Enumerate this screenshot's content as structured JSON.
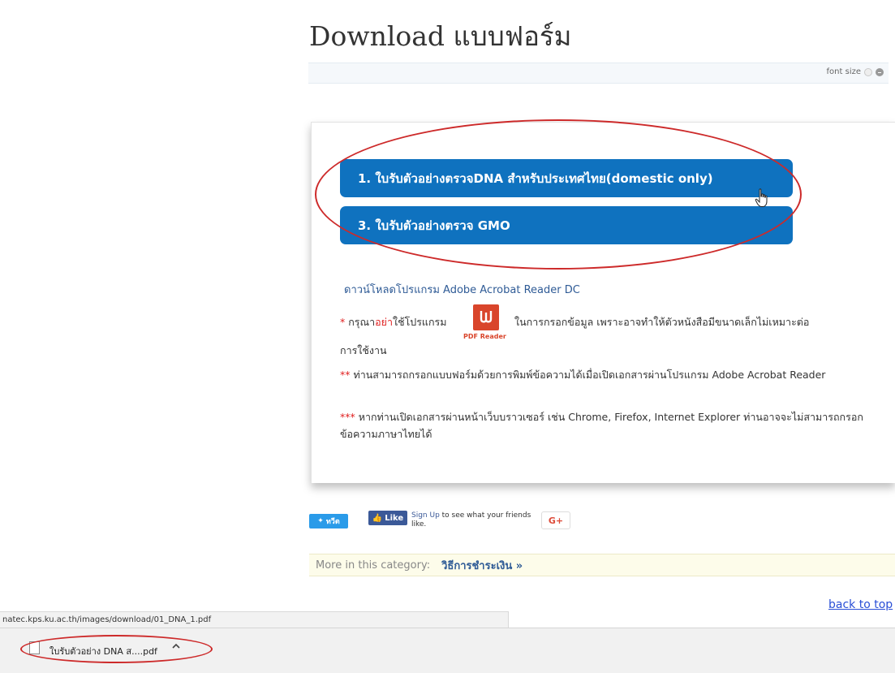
{
  "page": {
    "title": "Download แบบฟอร์ม",
    "font_size_label": "font size"
  },
  "downloads": {
    "buttons": [
      {
        "label": "1. ใบรับตัวอย่างตรวจDNA สำหรับประเทศไทย(domestic only)"
      },
      {
        "label": "3. ใบรับตัวอย่างตรวจ GMO"
      }
    ]
  },
  "acrobat": {
    "link_text": "ดาวน์โหลดโปรแกรม Adobe Acrobat Reader DC",
    "pdf_reader_label": "PDF Reader"
  },
  "notes": {
    "note1": {
      "marker": "*",
      "prefix": " กรุณา",
      "highlight": "อย่า",
      "middle": "ใช้โปรแกรม",
      "suffix": "ในการกรอกข้อมูล เพราะอาจทำให้ตัวหนังสือมีขนาดเล็กไม่เหมาะต่อ",
      "line2": "การใช้งาน"
    },
    "note2": {
      "marker": "**",
      "text": " ท่านสามารถกรอกแบบฟอร์มด้วยการพิมพ์ข้อความได้เมื่อเปิดเอกสารผ่านโปรแกรม Adobe Acrobat Reader"
    },
    "note3": {
      "marker": "***",
      "text": " หากท่านเปิดเอกสารผ่านหน้าเว็บบราวเซอร์ เช่น Chrome, Firefox, Internet Explorer ท่านอาจจะไม่สามารถกรอกข้อความภาษาไทยได้"
    }
  },
  "share": {
    "twitter_label": "ทวีต",
    "facebook_like_label": "Like",
    "facebook_signup": "Sign Up",
    "facebook_text": " to see what your friends like.",
    "gplus_label": "G+"
  },
  "more": {
    "label": "More in this category:",
    "link": "วิธีการชำระเงิน »"
  },
  "footer": {
    "back_to_top": "back to top"
  },
  "browser": {
    "status_url": "natec.kps.ku.ac.th/images/download/01_DNA_1.pdf",
    "download_file": "ใบรับตัวอย่าง DNA ส....pdf"
  },
  "colors": {
    "button_blue": "#0f72bf",
    "annotation_red": "#cd2a2a",
    "facebook_blue": "#3b5998",
    "twitter_blue": "#2a9be9"
  }
}
